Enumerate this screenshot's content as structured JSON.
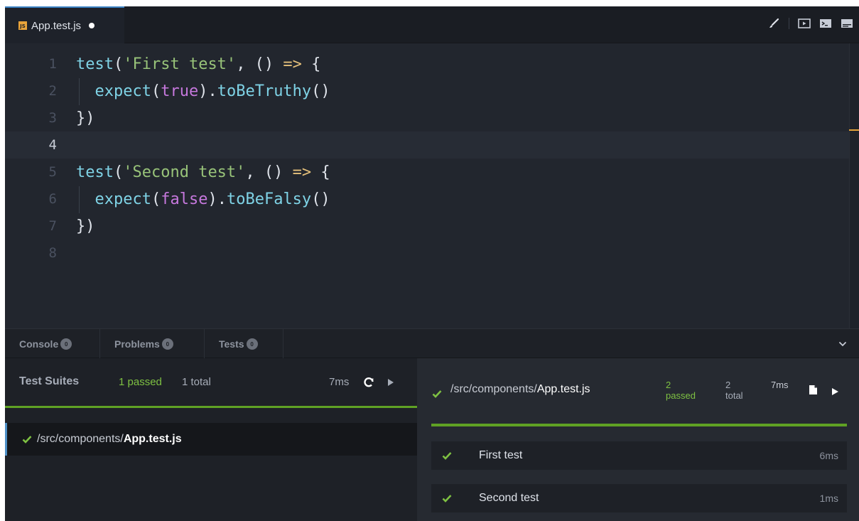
{
  "editor_tab": {
    "icon": "js-file-icon",
    "icon_text": "JS",
    "title": "App.test.js",
    "modified": true
  },
  "toolbar": {
    "icons": [
      "brush-icon",
      "preview-icon",
      "terminal-icon",
      "panel-icon"
    ]
  },
  "code_lines": [
    {
      "n": "1",
      "tokens": [
        [
          "t-call",
          "test"
        ],
        [
          "t-punc",
          "("
        ],
        [
          "t-str",
          "'First test'"
        ],
        [
          "t-punc",
          ", () "
        ],
        [
          "t-op",
          "=>"
        ],
        [
          "t-punc",
          " {"
        ]
      ]
    },
    {
      "n": "2",
      "indent": true,
      "tokens": [
        [
          "t-call",
          "expect"
        ],
        [
          "t-punc",
          "("
        ],
        [
          "t-kw",
          "true"
        ],
        [
          "t-punc",
          ")."
        ],
        [
          "t-call",
          "toBeTruthy"
        ],
        [
          "t-punc",
          "()"
        ]
      ]
    },
    {
      "n": "3",
      "tokens": [
        [
          "t-punc",
          "})"
        ]
      ]
    },
    {
      "n": "4",
      "active": true,
      "tokens": []
    },
    {
      "n": "5",
      "tokens": [
        [
          "t-call",
          "test"
        ],
        [
          "t-punc",
          "("
        ],
        [
          "t-str",
          "'Second test'"
        ],
        [
          "t-punc",
          ", () "
        ],
        [
          "t-op",
          "=>"
        ],
        [
          "t-punc",
          " {"
        ]
      ]
    },
    {
      "n": "6",
      "indent": true,
      "tokens": [
        [
          "t-call",
          "expect"
        ],
        [
          "t-punc",
          "("
        ],
        [
          "t-kw",
          "false"
        ],
        [
          "t-punc",
          ")."
        ],
        [
          "t-call",
          "toBeFalsy"
        ],
        [
          "t-punc",
          "()"
        ]
      ]
    },
    {
      "n": "7",
      "tokens": [
        [
          "t-punc",
          "})"
        ]
      ]
    },
    {
      "n": "8",
      "tokens": []
    }
  ],
  "panel_tabs": [
    {
      "label": "Console",
      "count": "0"
    },
    {
      "label": "Problems",
      "count": "0"
    },
    {
      "label": "Tests",
      "count": "0"
    }
  ],
  "suites": {
    "title": "Test Suites",
    "passed": "1 passed",
    "total": "1 total",
    "time": "7ms",
    "file_dir": "/src/components/",
    "file_name": "App.test.js"
  },
  "results": {
    "dir": "/src/components/",
    "file": "App.test.js",
    "passed_count": "2",
    "passed_label": "passed",
    "total_count": "2",
    "total_label": "total",
    "time": "7ms",
    "tests": [
      {
        "name": "First test",
        "time": "6ms"
      },
      {
        "name": "Second test",
        "time": "1ms"
      }
    ]
  },
  "colors": {
    "accent_green": "#5fa124",
    "pass_text": "#7ec142",
    "selection_blue": "#4d8fc7",
    "modified_marker": "#e5a43a"
  }
}
